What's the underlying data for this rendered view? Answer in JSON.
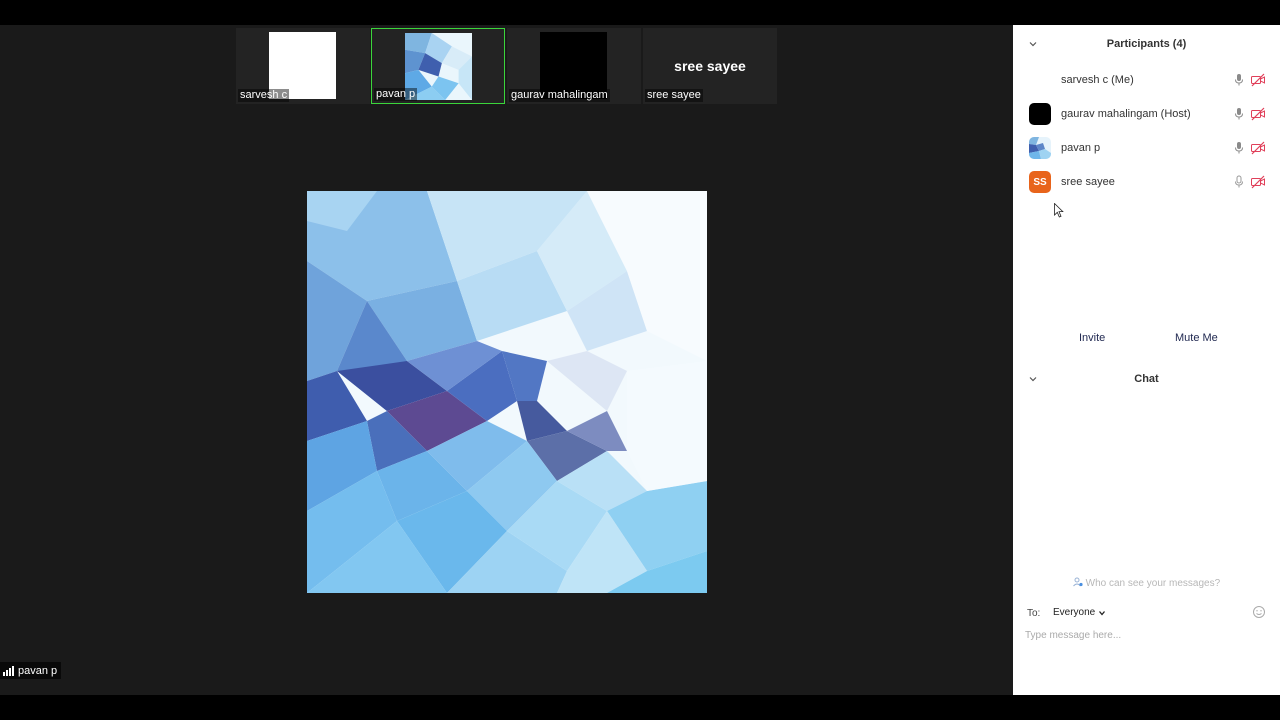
{
  "gallery": [
    {
      "name": "sarvesh c",
      "kind": "white"
    },
    {
      "name": "pavan p",
      "kind": "image",
      "active": true
    },
    {
      "name": "gaurav mahalingam",
      "kind": "black"
    },
    {
      "name": "sree sayee",
      "kind": "text",
      "display": "sree sayee"
    }
  ],
  "speaker": {
    "name": "pavan p",
    "icon": "signal-strength-icon"
  },
  "participants": {
    "title": "Participants (4)",
    "items": [
      {
        "name": "sarvesh c (Me)",
        "avatar": "none"
      },
      {
        "name": "gaurav mahalingam (Host)",
        "avatar": "black"
      },
      {
        "name": "pavan p",
        "avatar": "image"
      },
      {
        "name": "sree sayee",
        "avatar": "initials",
        "initials": "SS",
        "color": "#e8641b"
      }
    ],
    "invite_label": "Invite",
    "mute_me_label": "Mute Me"
  },
  "chat": {
    "title": "Chat",
    "visibility_notice": "Who can see your messages?",
    "to_label": "To:",
    "recipient": "Everyone",
    "placeholder": "Type message here..."
  },
  "colors": {
    "active_tile_border": "#3bd63b",
    "muted_icon": "#e0405a",
    "initials_avatar": "#e8641b"
  }
}
